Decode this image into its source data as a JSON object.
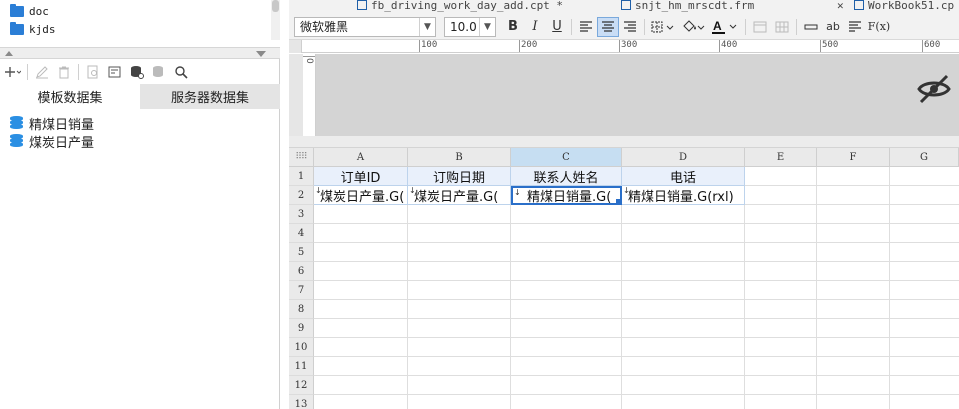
{
  "tree": {
    "items": [
      {
        "label": "doc",
        "icon": "folder-icon"
      },
      {
        "label": "kjds",
        "icon": "folder-icon"
      }
    ]
  },
  "datasets": {
    "tabs": [
      "模板数据集",
      "服务器数据集"
    ],
    "items": [
      "精煤日销量",
      "煤炭日产量"
    ]
  },
  "doc_tabs": [
    "fb_driving_work_day_add.cpt *",
    "snjt_hm_mrscdt.frm",
    "WorkBook51.cp"
  ],
  "format": {
    "font_name": "微软雅黑",
    "font_size": "10.0",
    "bold": "B",
    "italic": "I",
    "underline": "U",
    "text_tool": "ab",
    "formula": "F(x)"
  },
  "ruler": {
    "marks": [
      "100",
      "200",
      "300",
      "400",
      "500",
      "600"
    ],
    "vertical": "0"
  },
  "sheet": {
    "columns": [
      "A",
      "B",
      "C",
      "D",
      "E",
      "F",
      "G"
    ],
    "rows": [
      "1",
      "2",
      "3",
      "4",
      "5",
      "6",
      "7",
      "8",
      "9",
      "10",
      "11",
      "12",
      "13"
    ],
    "header_row": [
      "订单ID",
      "订购日期",
      "联系人姓名",
      "电话"
    ],
    "data_row": [
      "煤炭日产量.G(",
      "煤炭日产量.G(",
      "精煤日销量.G(",
      "精煤日销量.G(rxl)"
    ],
    "selected_column": "C",
    "selected_cell": "C2"
  },
  "colors": {
    "accent": "#2a6fc9",
    "folder": "#2b7ed6",
    "dataset": "#2b8fe3",
    "header_fill": "#e9f0fb"
  }
}
